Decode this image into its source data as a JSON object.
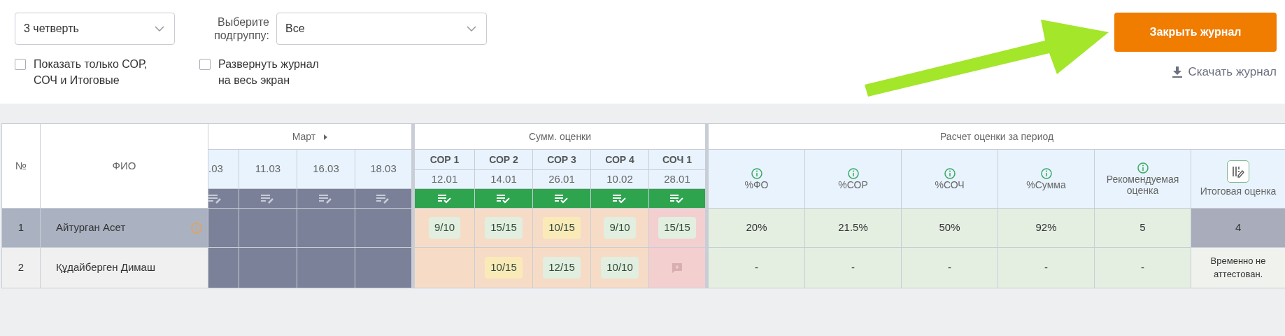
{
  "filters": {
    "quarter": {
      "value": "3 четверть"
    },
    "subgroup": {
      "label": "Выберите подгруппу:",
      "value": "Все"
    }
  },
  "checkboxes": [
    {
      "label": "Показать только СОР, СОЧ и Итоговые",
      "checked": false
    },
    {
      "label": "Развернуть журнал на весь экран",
      "checked": false
    }
  ],
  "close_button": "Закрыть журнал",
  "download_link": "Скачать журнал",
  "table": {
    "number_header": "№",
    "name_header": "ФИО",
    "month": "Март",
    "dates": [
      ".03",
      "11.03",
      "16.03",
      "18.03"
    ],
    "summative": {
      "title": "Сумм. оценки",
      "items": [
        {
          "name": "СОР 1",
          "date": "12.01",
          "kind": "sor"
        },
        {
          "name": "СОР 2",
          "date": "14.01",
          "kind": "sor"
        },
        {
          "name": "СОР 3",
          "date": "26.01",
          "kind": "sor"
        },
        {
          "name": "СОР 4",
          "date": "10.02",
          "kind": "sor"
        },
        {
          "name": "СОЧ 1",
          "date": "28.01",
          "kind": "soch"
        }
      ]
    },
    "period": {
      "title": "Расчет оценки за период",
      "columns": [
        {
          "label": "%ФО",
          "kind": "info"
        },
        {
          "label": "%СОР",
          "kind": "info"
        },
        {
          "label": "%СОЧ",
          "kind": "info"
        },
        {
          "label": "%Сумма",
          "kind": "info"
        },
        {
          "label": "Рекомендуемая оценка",
          "kind": "info"
        },
        {
          "label": "Итоговая оценка",
          "kind": "edit"
        }
      ]
    },
    "rows": [
      {
        "number": "1",
        "name": "Айтурган Асет",
        "selected": true,
        "alert": true,
        "summative": [
          {
            "kind": "grade",
            "grade": "9/10",
            "color": "#e2eedf"
          },
          {
            "kind": "grade",
            "grade": "15/15",
            "color": "#e2eedf"
          },
          {
            "kind": "grade",
            "grade": "10/15",
            "color": "#faeab8"
          },
          {
            "kind": "grade",
            "grade": "9/10",
            "color": "#e2eedf"
          },
          {
            "kind": "grade",
            "grade": "15/15",
            "color": "#e2eedf"
          }
        ],
        "period": [
          "20%",
          "21.5%",
          "50%",
          "92%",
          "5"
        ],
        "final": "4"
      },
      {
        "number": "2",
        "name": "Құдайберген Димаш",
        "selected": false,
        "alert": false,
        "summative": [
          {
            "kind": "empty"
          },
          {
            "kind": "grade",
            "grade": "10/15",
            "color": "#faeab8"
          },
          {
            "kind": "grade",
            "grade": "12/15",
            "color": "#e2eedf"
          },
          {
            "kind": "grade",
            "grade": "10/10",
            "color": "#e2eedf"
          },
          {
            "kind": "comment"
          }
        ],
        "period": [
          "-",
          "-",
          "-",
          "-",
          "-"
        ],
        "final": "Временно не аттестован."
      }
    ]
  }
}
